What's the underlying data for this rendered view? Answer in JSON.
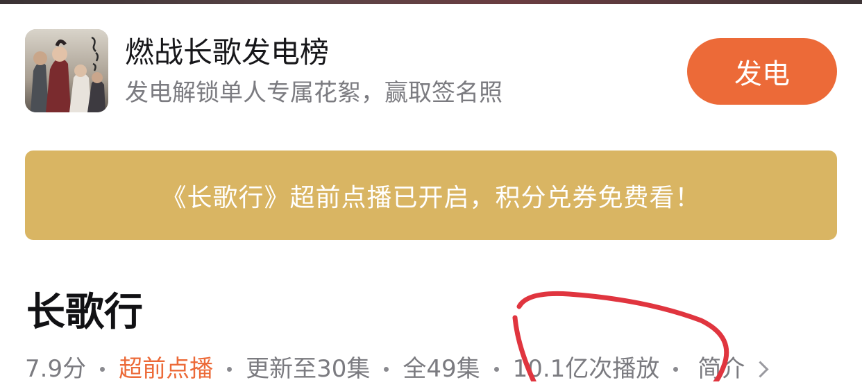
{
  "header": {
    "thumbnail_icon": "drama-poster-thumbnail",
    "title": "燃战长歌发电榜",
    "subtitle": "发电解锁单人专属花絮，赢取签名照",
    "power_button_label": "发电"
  },
  "banner": {
    "text": "《长歌行》超前点播已开启，积分兑券免费看！"
  },
  "show": {
    "title": "长歌行",
    "rating": "7.9分",
    "vip_tag": "超前点播",
    "updated": "更新至30集",
    "total": "全49集",
    "plays": "10.1亿次播放",
    "intro_label": "简介"
  },
  "colors": {
    "accent": "#ec6a38",
    "banner_gold": "#d9b563",
    "annotation_red": "#e0353f"
  }
}
